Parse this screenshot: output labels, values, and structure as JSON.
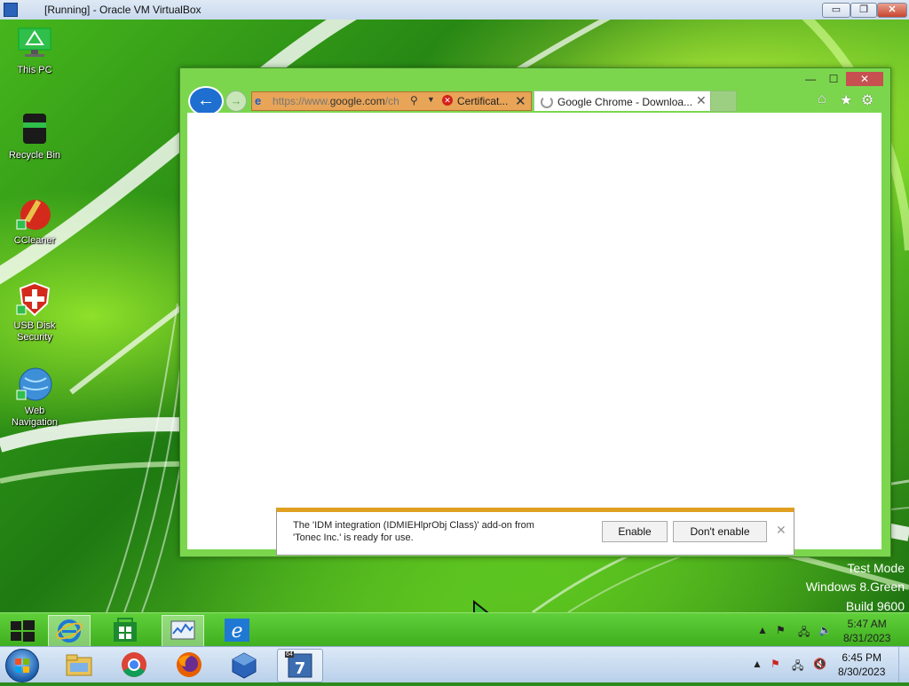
{
  "host": {
    "window_title": "[Running] - Oracle VM VirtualBox",
    "controls": {
      "minimize": "▭",
      "restore": "❐",
      "close": "✕"
    }
  },
  "desktop": {
    "icons": [
      {
        "label": "This PC",
        "icon": "this-pc-icon"
      },
      {
        "label": "Recycle Bin",
        "icon": "recycle-bin-icon"
      },
      {
        "label": "CCleaner",
        "icon": "ccleaner-icon"
      },
      {
        "label": "USB Disk Security",
        "icon": "usb-disk-security-icon"
      },
      {
        "label": "Web Navigation",
        "icon": "web-navigation-icon"
      }
    ],
    "watermark": {
      "line1": "Test Mode",
      "line2": "Windows 8.Green",
      "line3": "Build 9600"
    }
  },
  "ie": {
    "controls": {
      "minimize": "—",
      "maximize": "☐",
      "close": "✕"
    },
    "address": {
      "url_prefix": "https://www.",
      "url_host": "google.com",
      "url_suffix": "/ch",
      "certificate": "Certificat..."
    },
    "tab": {
      "label": "Google Chrome - Downloa...",
      "close": "✕"
    },
    "toolbar": {
      "home": "⌂",
      "favorites": "★",
      "tools": "⚙"
    },
    "notification": {
      "line1": "The 'IDM integration (IDMIEHlprObj Class)' add-on from",
      "line2": "'Tonec Inc.' is ready for use.",
      "enable": "Enable",
      "dont_enable": "Don't enable",
      "close": "✕"
    }
  },
  "guest_taskbar": {
    "tray_arrow": "▲",
    "clock_time": "5:47 AM",
    "clock_date": "8/31/2023"
  },
  "host_taskbar": {
    "tray_arrow": "▲",
    "clock_time": "6:45 PM",
    "clock_date": "8/30/2023",
    "vbox_badge": "64"
  },
  "colors": {
    "ie_frame": "#7bd64e",
    "notification_accent": "#e0a020",
    "ie_blue": "#1f6fd1",
    "close_red": "#c75050"
  }
}
